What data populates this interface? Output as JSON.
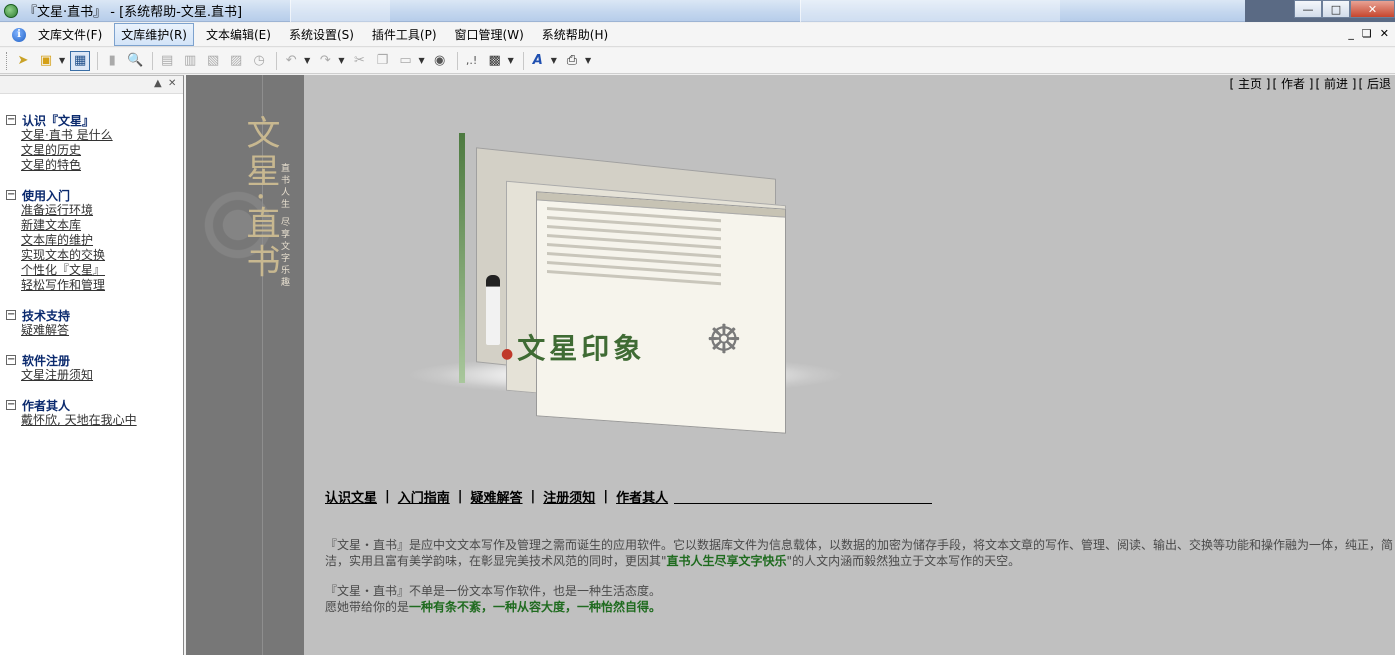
{
  "window": {
    "title": "『文星·直书』 - [系统帮助-文星.直书]"
  },
  "menu": {
    "items": [
      {
        "label": "文库文件(F)"
      },
      {
        "label": "文库维护(R)"
      },
      {
        "label": "文本编辑(E)"
      },
      {
        "label": "系统设置(S)"
      },
      {
        "label": "插件工具(P)"
      },
      {
        "label": "窗口管理(W)"
      },
      {
        "label": "系统帮助(H)"
      }
    ],
    "active_index": 1
  },
  "toolbar": {
    "icons": [
      "open-library-icon",
      "folder-icon",
      "view-toggle-icon",
      "delete-icon",
      "preview-icon",
      "print-setup-icon",
      "export-icon",
      "import-icon",
      "save-icon",
      "history-icon",
      "undo-icon",
      "redo-icon",
      "cut-icon",
      "copy-icon",
      "paste-icon",
      "find-icon",
      "punctuation-icon",
      "insert-icon",
      "font-color-icon",
      "printer-icon"
    ]
  },
  "left_panel": {
    "groups": [
      {
        "title": "认识『文星』",
        "links": [
          "文星·直书 是什么",
          "文星的历史",
          "文星的特色"
        ]
      },
      {
        "title": "使用入门",
        "links": [
          "准备运行环境",
          "新建文本库",
          "文本库的维护",
          "实现文本的交换",
          "个性化『文星』",
          "轻松写作和管理"
        ]
      },
      {
        "title": "技术支持",
        "links": [
          "疑难解答"
        ]
      },
      {
        "title": "软件注册",
        "links": [
          "文星注册须知"
        ]
      },
      {
        "title": "作者其人",
        "links": [
          "戴怀欣, 天地在我心中"
        ]
      }
    ]
  },
  "content": {
    "top_nav": [
      "[ 主页 ]",
      "[ 作者 ]",
      "[ 前进 ]",
      "[ 后退"
    ],
    "deco_calligraphy": "文星·直书",
    "deco_small_text": "直书人生 尽享文字乐趣",
    "logo_text": "文星印象",
    "bottom_nav": [
      "认识文星",
      "入门指南",
      "疑难解答",
      "注册须知",
      "作者其人"
    ],
    "intro": {
      "p1_before": "『文星・直书』是应中文文本写作及管理之需而诞生的应用软件。它以数据库文件为信息载体，以数据的加密为储存手段，将文本文章的写作、管理、阅读、输出、交换等功能和操作融为一体，纯正，简洁，实用且富有美学韵味，在彰显完美技术风范的同时，更因其\"",
      "p1_highlight": "直书人生尽享文字快乐",
      "p1_after": "\"的人文内涵而毅然独立于文本写作的天空。",
      "p2_line1": "『文星・直书』不单是一份文本写作软件，也是一种生活态度。",
      "p2_before": "愿她带给你的是",
      "p2_highlight": "一种有条不紊，一种从容大度，一种怡然自得。"
    }
  },
  "colors": {
    "accent_green": "#1f6b1f",
    "tree_title": "#0b2a6e",
    "content_bg": "#c0c0c0"
  }
}
